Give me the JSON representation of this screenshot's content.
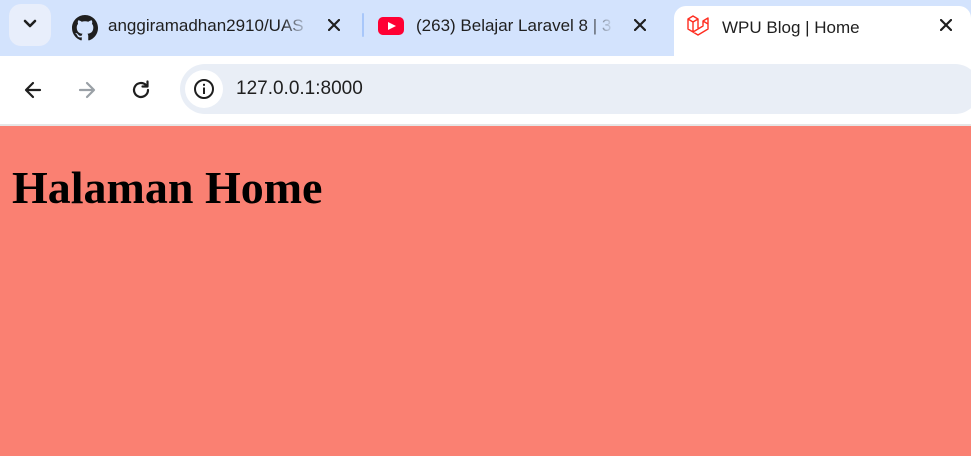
{
  "tabs": [
    {
      "title": "anggiramadhan2910/UAS",
      "icon": "github-icon",
      "active": false
    },
    {
      "title": "(263) Belajar Laravel 8 | 3",
      "icon": "youtube-icon",
      "active": false
    },
    {
      "title": "WPU Blog | Home",
      "icon": "laravel-icon",
      "active": true
    }
  ],
  "address_bar": {
    "url": "127.0.0.1:8000"
  },
  "page": {
    "heading": "Halaman Home",
    "background_color": "#fa8072"
  },
  "colors": {
    "tabbar": "#d3e3fd",
    "omnibox": "#e9eef6",
    "youtube": "#ff0033",
    "laravel": "#ff2d20"
  }
}
